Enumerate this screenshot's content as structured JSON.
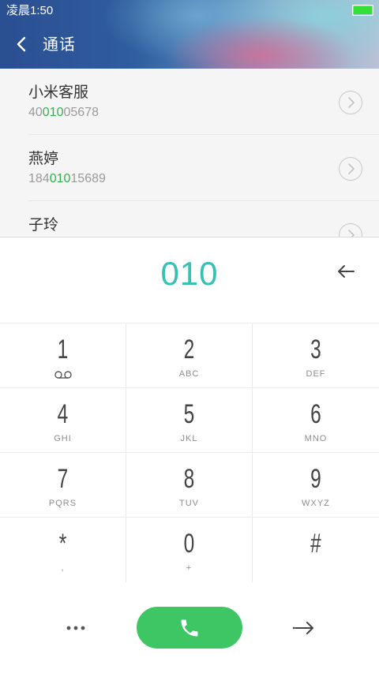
{
  "status_bar": {
    "time": "凌晨1:50",
    "battery_color": "#33e038"
  },
  "header": {
    "title": "通话",
    "back_icon": "chevron-left-icon"
  },
  "contacts": [
    {
      "name": "小米客服",
      "number_pre": "40",
      "number_match": "010",
      "number_post": "05678"
    },
    {
      "name": "燕婷",
      "number_pre": "184",
      "number_match": "010",
      "number_post": "15689"
    },
    {
      "name": "子玲",
      "number_pre": "",
      "number_match": "",
      "number_post": ""
    }
  ],
  "dial_input": {
    "value": "010",
    "color": "#35c2b2",
    "backspace_icon": "backspace-arrow-icon"
  },
  "keypad": {
    "keys": [
      {
        "digit": "1",
        "letters": ""
      },
      {
        "digit": "2",
        "letters": "ABC"
      },
      {
        "digit": "3",
        "letters": "DEF"
      },
      {
        "digit": "4",
        "letters": "GHI"
      },
      {
        "digit": "5",
        "letters": "JKL"
      },
      {
        "digit": "6",
        "letters": "MNO"
      },
      {
        "digit": "7",
        "letters": "PQRS"
      },
      {
        "digit": "8",
        "letters": "TUV"
      },
      {
        "digit": "9",
        "letters": "WXYZ"
      },
      {
        "digit": "*",
        "letters": ","
      },
      {
        "digit": "0",
        "letters": "+"
      },
      {
        "digit": "#",
        "letters": ""
      }
    ],
    "voicemail_icon": "voicemail-icon"
  },
  "actions": {
    "more_icon": "more-dots-icon",
    "call_icon": "phone-icon",
    "call_color": "#3ec664",
    "next_icon": "arrow-right-icon"
  },
  "colors": {
    "match_highlight": "#30b04c",
    "header_start": "#2a4f92"
  }
}
